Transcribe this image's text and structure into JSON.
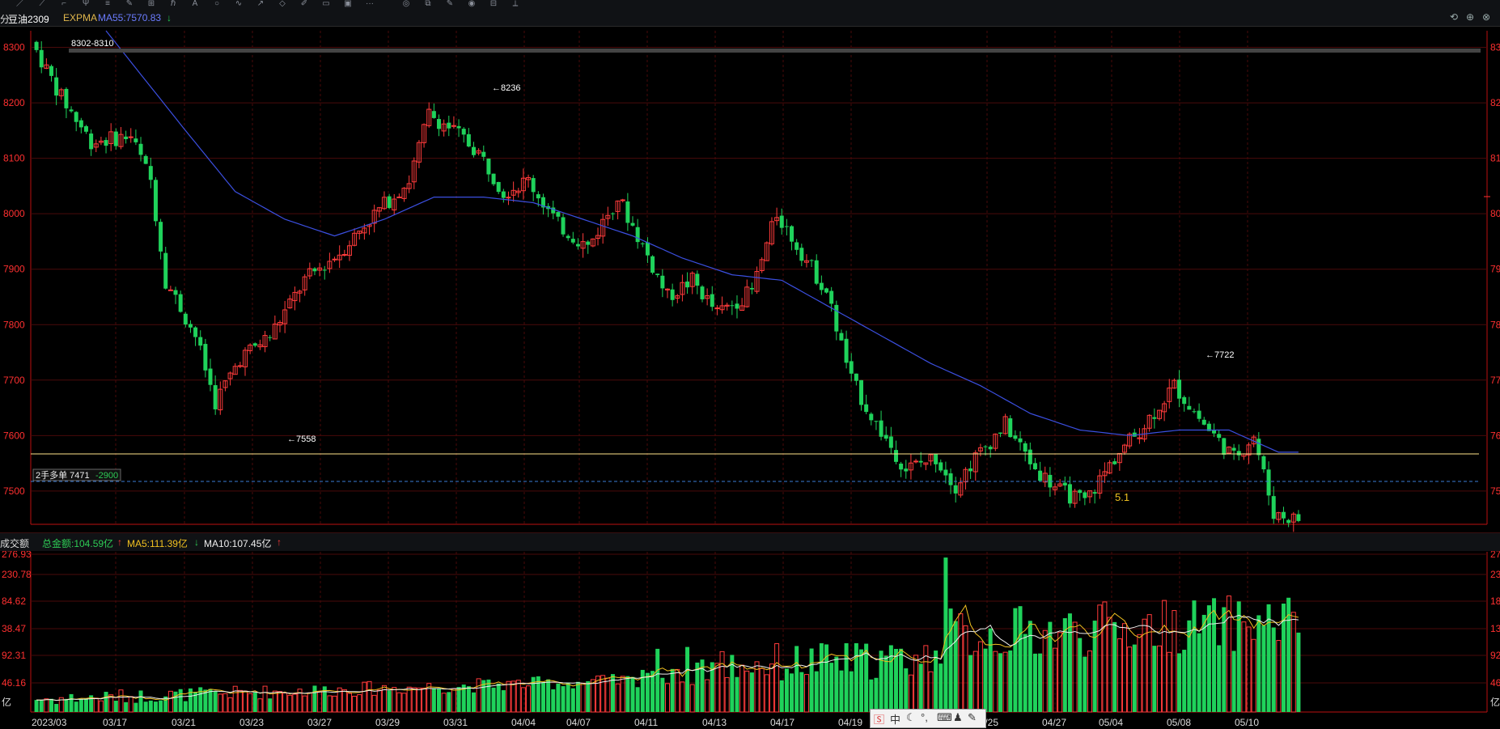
{
  "toolbar": {
    "tools": [
      "line-tool-icon",
      "ray-tool-icon",
      "segment-tool-icon",
      "pitchfork-tool-icon",
      "hline-tool-icon",
      "pen-tool-icon",
      "channel-tool-icon",
      "fib-tool-icon",
      "text-tool-icon",
      "circle-tool-icon",
      "wave-tool-icon",
      "arrow-tool-icon",
      "eraser-tool-icon",
      "brush-tool-icon",
      "rect-tool-icon",
      "gann-tool-icon",
      "more-tools-icon",
      "magnet-icon",
      "layers-icon",
      "edit-icon",
      "eye-icon",
      "delete-icon",
      "ruler-icon"
    ],
    "more_label": "···"
  },
  "header": {
    "prefix": "分",
    "symbol": "豆油2309",
    "indicator": "EXPMA",
    "ma_label": "MA55:7570.83",
    "ma_arrow": "↓"
  },
  "window_icons": [
    "restore-icon",
    "zoom-in-icon",
    "close-icon"
  ],
  "price_axis": {
    "labels": [
      "8300",
      "8200",
      "8100",
      "8000",
      "7900",
      "7800",
      "7700",
      "7600",
      "7500"
    ],
    "right_labels": [
      "83",
      "82",
      "81",
      "80",
      "79",
      "78",
      "77",
      "76",
      "75"
    ]
  },
  "annotations": {
    "range_label": "8302-8310",
    "high_8236": "←8236",
    "low_7558": "←7558",
    "high_7722": "←7722",
    "yellow_marker": "5.1"
  },
  "position": {
    "label": "2手多单  7471",
    "pnl": "-2900"
  },
  "volume_header": {
    "title": "成交额",
    "total": "总金额:104.59亿",
    "total_arrow": "↑",
    "ma5": "MA5:111.39亿",
    "ma5_arrow": "↓",
    "ma10": "MA10:107.45亿",
    "ma10_arrow": "↑"
  },
  "volume_axis": {
    "labels": [
      "276.93",
      "230.78",
      "84.62",
      "38.47",
      "92.31",
      "46.16",
      "亿"
    ],
    "right_labels": [
      "27",
      "23",
      "18",
      "13",
      "92",
      "46",
      "亿"
    ]
  },
  "date_axis": [
    "2023/03",
    "03/17",
    "03/21",
    "03/23",
    "03/27",
    "03/29",
    "03/31",
    "04/04",
    "04/07",
    "04/11",
    "04/13",
    "04/17",
    "04/19",
    "04/25",
    "04/27",
    "05/04",
    "05/08",
    "05/10"
  ],
  "ime_bar": {
    "mode": "中",
    "items": [
      "ime-logo-icon",
      "ime-moon-icon",
      "ime-punct-icon",
      "ime-keyboard-icon",
      "ime-user-icon",
      "ime-settings-icon"
    ]
  },
  "colors": {
    "up": "#ff3b3b",
    "down": "#1fd25b",
    "grid": "#4a0a0a",
    "axis": "#ff3030",
    "ma_line": "#3b4fe0",
    "position_line": "#ffe38a"
  },
  "chart_data": {
    "type": "candlestick",
    "symbol": "豆油2309",
    "ylim": [
      7440,
      8330
    ],
    "ma55_last": 7570.83,
    "anchors": [
      [
        0,
        8310
      ],
      [
        6,
        8210
      ],
      [
        12,
        8130
      ],
      [
        20,
        8140
      ],
      [
        24,
        8060
      ],
      [
        27,
        7880
      ],
      [
        33,
        7780
      ],
      [
        37,
        7660
      ],
      [
        42,
        7740
      ],
      [
        48,
        7780
      ],
      [
        55,
        7880
      ],
      [
        62,
        7930
      ],
      [
        68,
        7990
      ],
      [
        76,
        8060
      ],
      [
        80,
        8180
      ],
      [
        85,
        8150
      ],
      [
        90,
        8110
      ],
      [
        95,
        8040
      ],
      [
        100,
        8060
      ],
      [
        106,
        7980
      ],
      [
        112,
        7940
      ],
      [
        118,
        8030
      ],
      [
        122,
        7960
      ],
      [
        128,
        7850
      ],
      [
        133,
        7880
      ],
      [
        138,
        7820
      ],
      [
        145,
        7860
      ],
      [
        150,
        8000
      ],
      [
        155,
        7930
      ],
      [
        160,
        7860
      ],
      [
        165,
        7700
      ],
      [
        170,
        7620
      ],
      [
        176,
        7540
      ],
      [
        182,
        7560
      ],
      [
        186,
        7510
      ],
      [
        190,
        7560
      ],
      [
        196,
        7620
      ],
      [
        202,
        7540
      ],
      [
        207,
        7500
      ],
      [
        212,
        7480
      ],
      [
        218,
        7560
      ],
      [
        224,
        7620
      ],
      [
        230,
        7690
      ],
      [
        236,
        7620
      ],
      [
        242,
        7560
      ],
      [
        246,
        7600
      ],
      [
        250,
        7460
      ],
      [
        254,
        7450
      ]
    ],
    "ma55_anchors": [
      [
        14,
        8330
      ],
      [
        30,
        8150
      ],
      [
        40,
        8040
      ],
      [
        50,
        7990
      ],
      [
        60,
        7960
      ],
      [
        70,
        7990
      ],
      [
        80,
        8030
      ],
      [
        90,
        8030
      ],
      [
        100,
        8020
      ],
      [
        110,
        7990
      ],
      [
        120,
        7960
      ],
      [
        130,
        7920
      ],
      [
        140,
        7890
      ],
      [
        150,
        7880
      ],
      [
        160,
        7830
      ],
      [
        170,
        7780
      ],
      [
        180,
        7730
      ],
      [
        190,
        7690
      ],
      [
        200,
        7640
      ],
      [
        210,
        7610
      ],
      [
        220,
        7600
      ],
      [
        230,
        7610
      ],
      [
        240,
        7610
      ],
      [
        250,
        7570
      ]
    ],
    "volume": {
      "ylim": [
        0,
        280
      ],
      "series_note": "daily turnover bars, MA5 and MA10 overlays"
    }
  }
}
